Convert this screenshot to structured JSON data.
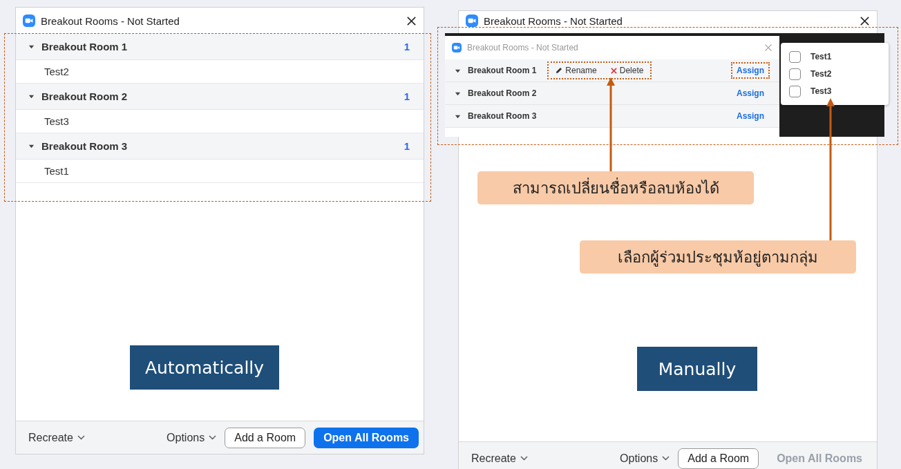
{
  "windows": [
    {
      "title": "Breakout Rooms - Not Started",
      "rooms": [
        {
          "name": "Breakout Room 1",
          "count": "1",
          "expanded": true,
          "participants": [
            "Test2"
          ]
        },
        {
          "name": "Breakout Room 2",
          "count": "1",
          "expanded": true,
          "participants": [
            "Test3"
          ]
        },
        {
          "name": "Breakout Room 3",
          "count": "1",
          "expanded": true,
          "participants": [
            "Test1"
          ]
        }
      ],
      "caption": "Automatically",
      "footer": {
        "recreate": "Recreate",
        "options": "Options",
        "add_room": "Add a Room",
        "open_all": {
          "label": "Open All Rooms",
          "disabled": false
        }
      }
    },
    {
      "title": "Breakout Rooms - Not Started",
      "caption": "Manually",
      "footer": {
        "recreate": "Recreate",
        "options": "Options",
        "add_room": "Add a Room",
        "open_all": {
          "label": "Open All Rooms",
          "disabled": true
        }
      }
    }
  ],
  "inset": {
    "title": "Breakout Rooms - Not Started",
    "rooms": [
      {
        "name": "Breakout Room 1",
        "expanded": true,
        "actions": [
          {
            "kind": "rename",
            "label": "Rename"
          },
          {
            "kind": "delete",
            "label": "Delete"
          }
        ],
        "assign": "Assign",
        "highlighted": true
      },
      {
        "name": "Breakout Room 2",
        "expanded": true,
        "assign": "Assign",
        "highlighted": false
      },
      {
        "name": "Breakout Room 3",
        "expanded": true,
        "assign": "Assign",
        "highlighted": false
      }
    ],
    "assign_menu": [
      {
        "label": "Test1",
        "checked": false
      },
      {
        "label": "Test2",
        "checked": false
      },
      {
        "label": "Test3",
        "checked": false
      }
    ]
  },
  "callouts": [
    "สามารถเปลี่ยนชื่อหรือลบห้องได้",
    "เลือกผู้ร่วมประชุมห้อยู่ตามกลุ่ม"
  ]
}
